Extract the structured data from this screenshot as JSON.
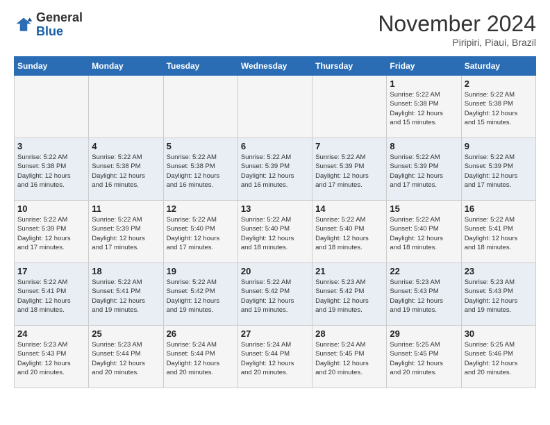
{
  "logo": {
    "general": "General",
    "blue": "Blue"
  },
  "title": "November 2024",
  "location": "Piripiri, Piaui, Brazil",
  "weekdays": [
    "Sunday",
    "Monday",
    "Tuesday",
    "Wednesday",
    "Thursday",
    "Friday",
    "Saturday"
  ],
  "weeks": [
    [
      {
        "day": "",
        "info": ""
      },
      {
        "day": "",
        "info": ""
      },
      {
        "day": "",
        "info": ""
      },
      {
        "day": "",
        "info": ""
      },
      {
        "day": "",
        "info": ""
      },
      {
        "day": "1",
        "info": "Sunrise: 5:22 AM\nSunset: 5:38 PM\nDaylight: 12 hours\nand 15 minutes."
      },
      {
        "day": "2",
        "info": "Sunrise: 5:22 AM\nSunset: 5:38 PM\nDaylight: 12 hours\nand 15 minutes."
      }
    ],
    [
      {
        "day": "3",
        "info": "Sunrise: 5:22 AM\nSunset: 5:38 PM\nDaylight: 12 hours\nand 16 minutes."
      },
      {
        "day": "4",
        "info": "Sunrise: 5:22 AM\nSunset: 5:38 PM\nDaylight: 12 hours\nand 16 minutes."
      },
      {
        "day": "5",
        "info": "Sunrise: 5:22 AM\nSunset: 5:38 PM\nDaylight: 12 hours\nand 16 minutes."
      },
      {
        "day": "6",
        "info": "Sunrise: 5:22 AM\nSunset: 5:39 PM\nDaylight: 12 hours\nand 16 minutes."
      },
      {
        "day": "7",
        "info": "Sunrise: 5:22 AM\nSunset: 5:39 PM\nDaylight: 12 hours\nand 17 minutes."
      },
      {
        "day": "8",
        "info": "Sunrise: 5:22 AM\nSunset: 5:39 PM\nDaylight: 12 hours\nand 17 minutes."
      },
      {
        "day": "9",
        "info": "Sunrise: 5:22 AM\nSunset: 5:39 PM\nDaylight: 12 hours\nand 17 minutes."
      }
    ],
    [
      {
        "day": "10",
        "info": "Sunrise: 5:22 AM\nSunset: 5:39 PM\nDaylight: 12 hours\nand 17 minutes."
      },
      {
        "day": "11",
        "info": "Sunrise: 5:22 AM\nSunset: 5:39 PM\nDaylight: 12 hours\nand 17 minutes."
      },
      {
        "day": "12",
        "info": "Sunrise: 5:22 AM\nSunset: 5:40 PM\nDaylight: 12 hours\nand 17 minutes."
      },
      {
        "day": "13",
        "info": "Sunrise: 5:22 AM\nSunset: 5:40 PM\nDaylight: 12 hours\nand 18 minutes."
      },
      {
        "day": "14",
        "info": "Sunrise: 5:22 AM\nSunset: 5:40 PM\nDaylight: 12 hours\nand 18 minutes."
      },
      {
        "day": "15",
        "info": "Sunrise: 5:22 AM\nSunset: 5:40 PM\nDaylight: 12 hours\nand 18 minutes."
      },
      {
        "day": "16",
        "info": "Sunrise: 5:22 AM\nSunset: 5:41 PM\nDaylight: 12 hours\nand 18 minutes."
      }
    ],
    [
      {
        "day": "17",
        "info": "Sunrise: 5:22 AM\nSunset: 5:41 PM\nDaylight: 12 hours\nand 18 minutes."
      },
      {
        "day": "18",
        "info": "Sunrise: 5:22 AM\nSunset: 5:41 PM\nDaylight: 12 hours\nand 19 minutes."
      },
      {
        "day": "19",
        "info": "Sunrise: 5:22 AM\nSunset: 5:42 PM\nDaylight: 12 hours\nand 19 minutes."
      },
      {
        "day": "20",
        "info": "Sunrise: 5:22 AM\nSunset: 5:42 PM\nDaylight: 12 hours\nand 19 minutes."
      },
      {
        "day": "21",
        "info": "Sunrise: 5:23 AM\nSunset: 5:42 PM\nDaylight: 12 hours\nand 19 minutes."
      },
      {
        "day": "22",
        "info": "Sunrise: 5:23 AM\nSunset: 5:43 PM\nDaylight: 12 hours\nand 19 minutes."
      },
      {
        "day": "23",
        "info": "Sunrise: 5:23 AM\nSunset: 5:43 PM\nDaylight: 12 hours\nand 19 minutes."
      }
    ],
    [
      {
        "day": "24",
        "info": "Sunrise: 5:23 AM\nSunset: 5:43 PM\nDaylight: 12 hours\nand 20 minutes."
      },
      {
        "day": "25",
        "info": "Sunrise: 5:23 AM\nSunset: 5:44 PM\nDaylight: 12 hours\nand 20 minutes."
      },
      {
        "day": "26",
        "info": "Sunrise: 5:24 AM\nSunset: 5:44 PM\nDaylight: 12 hours\nand 20 minutes."
      },
      {
        "day": "27",
        "info": "Sunrise: 5:24 AM\nSunset: 5:44 PM\nDaylight: 12 hours\nand 20 minutes."
      },
      {
        "day": "28",
        "info": "Sunrise: 5:24 AM\nSunset: 5:45 PM\nDaylight: 12 hours\nand 20 minutes."
      },
      {
        "day": "29",
        "info": "Sunrise: 5:25 AM\nSunset: 5:45 PM\nDaylight: 12 hours\nand 20 minutes."
      },
      {
        "day": "30",
        "info": "Sunrise: 5:25 AM\nSunset: 5:46 PM\nDaylight: 12 hours\nand 20 minutes."
      }
    ]
  ]
}
